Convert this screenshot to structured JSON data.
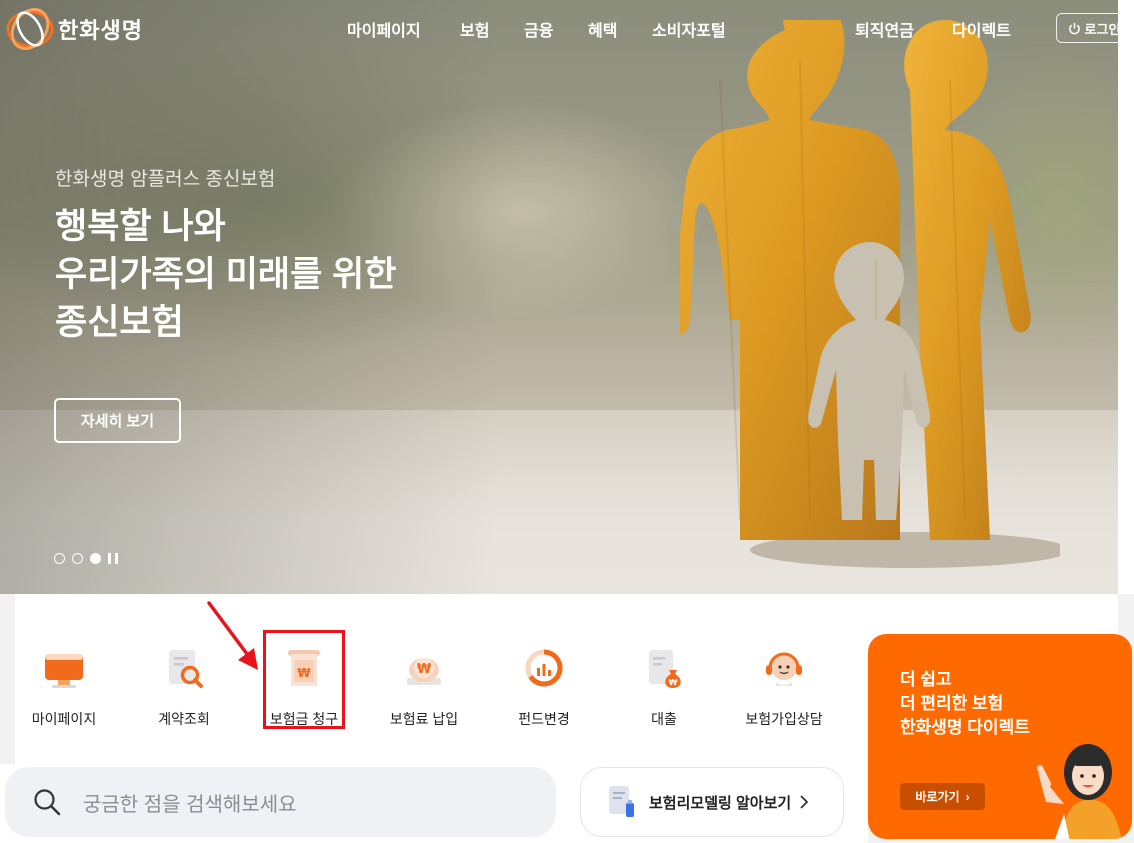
{
  "header": {
    "brand": "한화생명",
    "nav": [
      "마이페이지",
      "보험",
      "금융",
      "혜택",
      "소비자포털",
      "퇴직연금",
      "다이렉트"
    ],
    "login_label": "로그인"
  },
  "hero": {
    "subtitle": "한화생명 암플러스 종신보험",
    "title_lines": [
      "행복할 나와",
      "우리가족의 미래를 위한",
      "종신보험"
    ],
    "cta_label": "자세히 보기",
    "slides_total": 3,
    "slide_active": 3
  },
  "quick_menu": {
    "items": [
      {
        "label": "마이페이지",
        "icon": "monitor-icon"
      },
      {
        "label": "계약조회",
        "icon": "document-search-icon"
      },
      {
        "label": "보험금 청구",
        "icon": "claim-receipt-icon"
      },
      {
        "label": "보험료 납입",
        "icon": "won-payment-icon"
      },
      {
        "label": "펀드변경",
        "icon": "fund-chart-icon"
      },
      {
        "label": "대출",
        "icon": "loan-moneybag-icon"
      },
      {
        "label": "보험가입상담",
        "icon": "headset-consult-icon"
      }
    ],
    "highlighted": "보험금 청구"
  },
  "promo": {
    "lines": [
      "더 쉽고",
      "더 편리한 보험",
      "한화생명 다이렉트"
    ],
    "button_label": "바로가기"
  },
  "search": {
    "placeholder": "궁금한 점을 검색해보세요"
  },
  "remodel": {
    "label": "보험리모델링 알아보기"
  },
  "colors": {
    "brand_orange": "#ff6a00",
    "highlight_red": "#e8141c",
    "icon_orange": "#f26a1b"
  }
}
